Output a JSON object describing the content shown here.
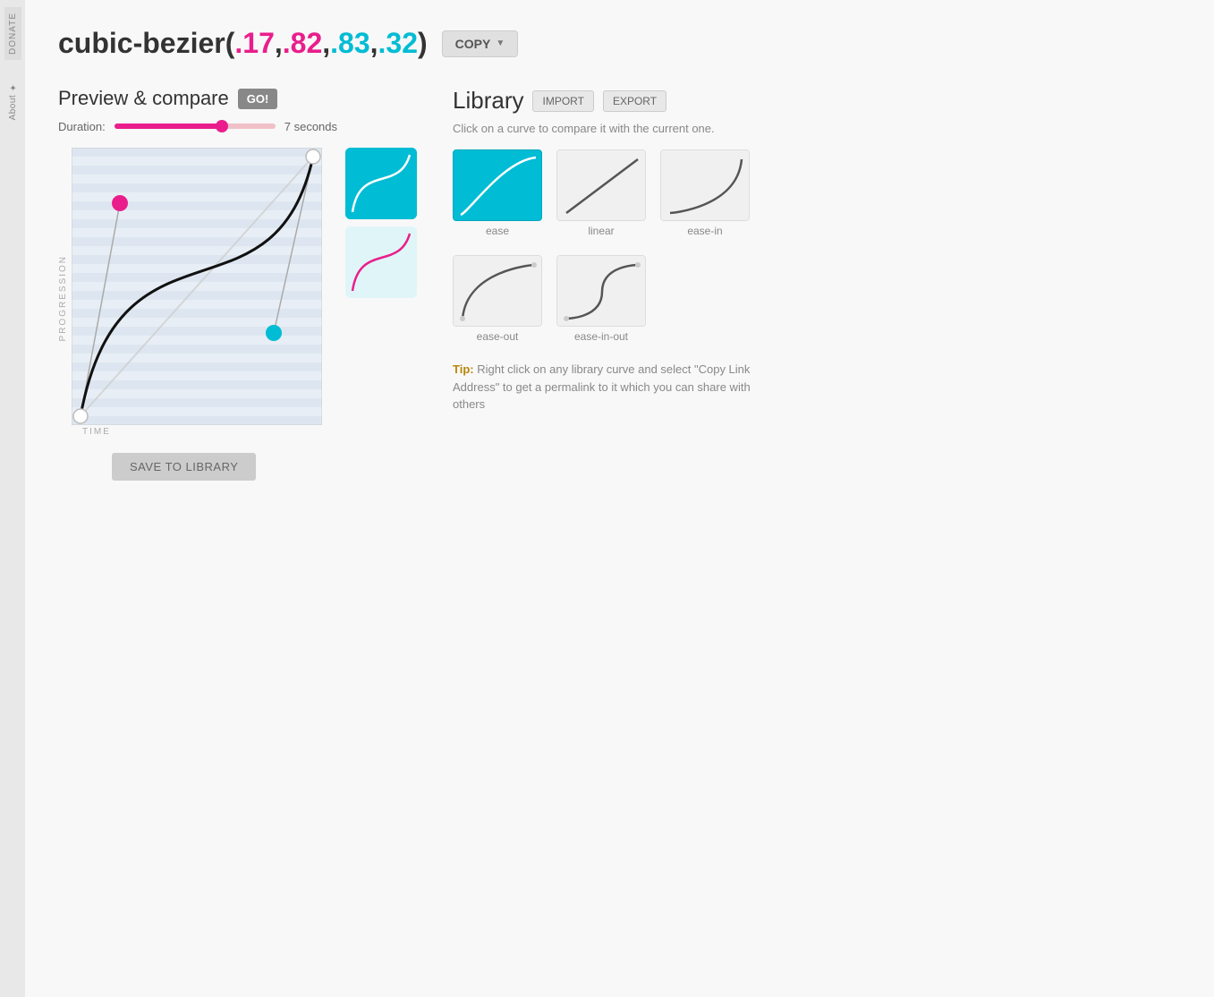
{
  "sidebar": {
    "donate_label": "DONATE",
    "about_label": "About ✦"
  },
  "header": {
    "title_prefix": "cubic-bezier(",
    "p1": ".17",
    "comma1": ",",
    "p2": ".82",
    "comma2": ",",
    "p3": ".83",
    "comma3": ",",
    "p4": ".32",
    "title_suffix": ")",
    "copy_label": "COPY",
    "copy_arrow": "▼"
  },
  "preview": {
    "title": "Preview & compare",
    "go_label": "GO!",
    "duration_label": "Duration:",
    "duration_value": "7 seconds",
    "duration_percent": 67
  },
  "canvas": {
    "axis_progression": "PROGRESSION",
    "axis_time": "TIME",
    "save_label": "SAVE TO LIBRARY",
    "p1x": 0.17,
    "p1y": 0.82,
    "p2x": 0.83,
    "p2y": 0.32
  },
  "library": {
    "title": "Library",
    "import_label": "IMPORT",
    "export_label": "EXPORT",
    "subtitle": "Click on a curve to compare it with the current one.",
    "curves": [
      {
        "name": "ease",
        "selected": true
      },
      {
        "name": "linear",
        "selected": false
      },
      {
        "name": "ease-in",
        "selected": false
      },
      {
        "name": "ease-out",
        "selected": false
      },
      {
        "name": "ease-in-out",
        "selected": false
      }
    ],
    "tip_prefix": "Tip:",
    "tip_text": " Right click on any library curve and select \"Copy Link Address\" to get a permalink to it which you can share with others"
  }
}
